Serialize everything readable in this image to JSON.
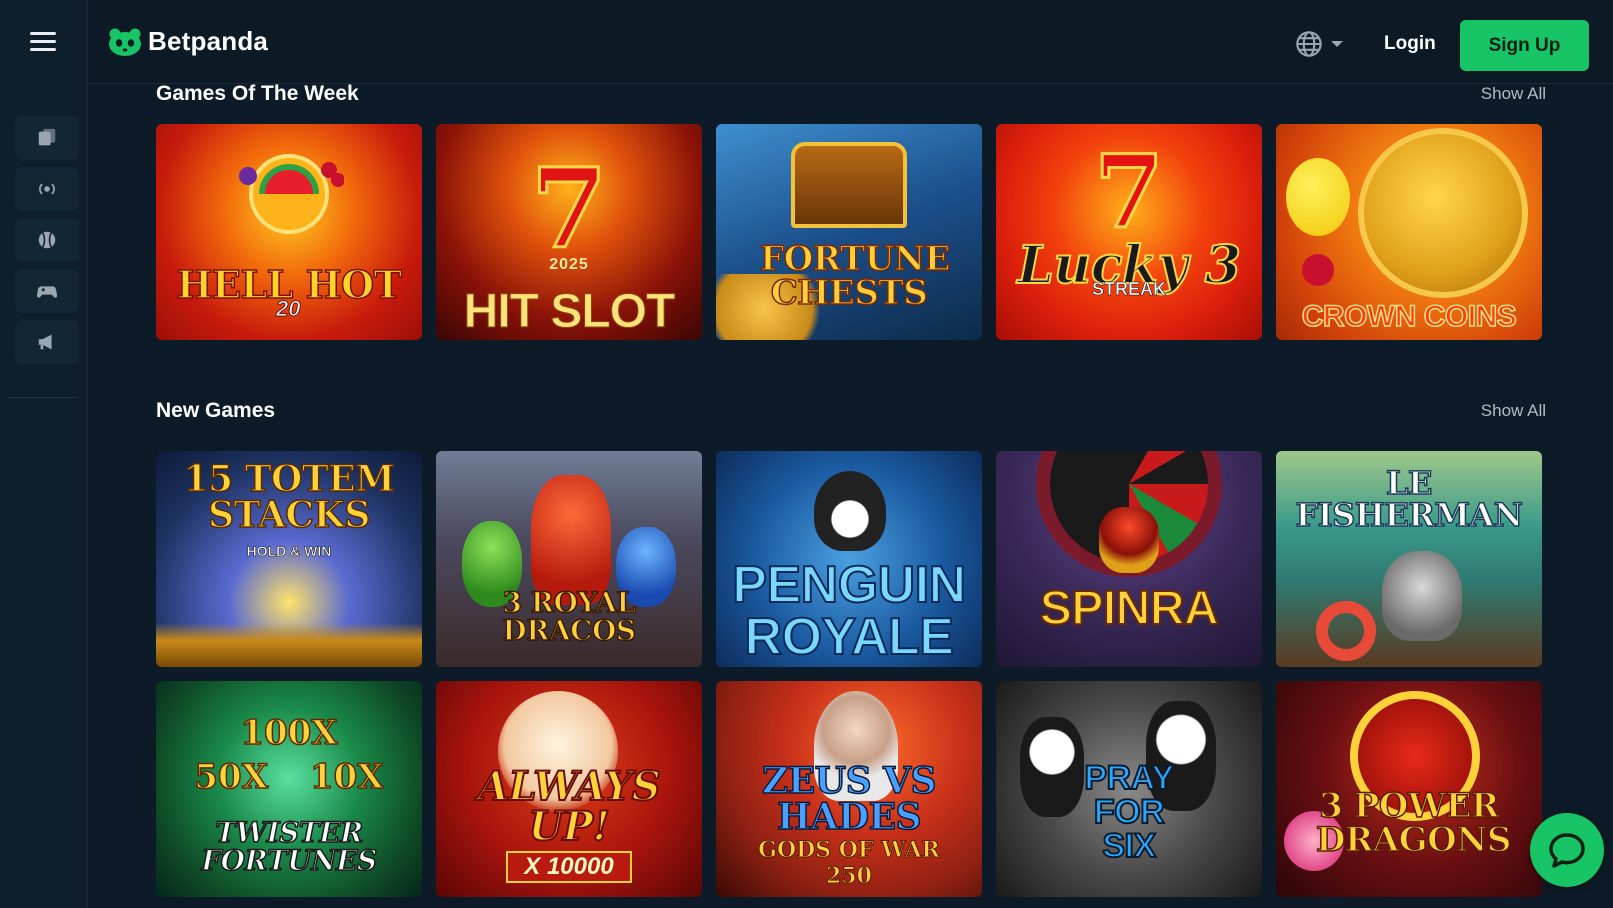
{
  "brand": {
    "name": "Betpanda",
    "accent": "#18c566"
  },
  "header": {
    "login_label": "Login",
    "signup_label": "Sign Up",
    "language_icon": "globe-icon"
  },
  "sidebar": {
    "menu_icon": "menu-icon",
    "items": [
      {
        "icon": "casino-icon"
      },
      {
        "icon": "live-icon"
      },
      {
        "icon": "sports-ball-icon"
      },
      {
        "icon": "gamepad-icon"
      },
      {
        "icon": "megaphone-icon"
      }
    ]
  },
  "sections": [
    {
      "title": "Games Of The Week",
      "show_all": "Show All",
      "games": [
        {
          "title": "HELL HOT",
          "sub": "20",
          "bg": "#c81a0c"
        },
        {
          "title": "HIT SLOT",
          "sub": "2025",
          "bg": "#8a1208"
        },
        {
          "title": "FORTUNE CHESTS",
          "sub": "",
          "bg": "#1b4f8a"
        },
        {
          "title": "Lucky 3",
          "sub": "STREAK",
          "bg": "#d91e0c"
        },
        {
          "title": "CROWN COINS",
          "sub": "",
          "bg": "#e0530a"
        }
      ]
    },
    {
      "title": "New Games",
      "show_all": "Show All",
      "games": [
        {
          "title": "15 TOTEM STACKS",
          "sub": "HOLD & WIN",
          "bg": "#1c3260"
        },
        {
          "title": "3 ROYAL DRACOS",
          "sub": "",
          "bg": "#3a3340"
        },
        {
          "title": "PENGUIN ROYALE",
          "sub": "",
          "bg": "#1a5aa0"
        },
        {
          "title": "SPINRA",
          "sub": "",
          "bg": "#3b2a5a"
        },
        {
          "title": "LE FISHERMAN",
          "sub": "",
          "bg": "#2f7a72"
        },
        {
          "title": "TWISTER FORTUNES",
          "sub": "100X 50X 10X",
          "bg": "#0f4a26"
        },
        {
          "title": "ALWAYS UP!",
          "sub": "X 10000",
          "bg": "#a8140c"
        },
        {
          "title": "ZEUS VS HADES",
          "sub": "GODS OF WAR 250",
          "bg": "#8e2012"
        },
        {
          "title": "PRAY FOR SIX",
          "sub": "",
          "bg": "#4a4a4a"
        },
        {
          "title": "3 POWER DRAGONS",
          "sub": "",
          "bg": "#6a0f12"
        }
      ]
    }
  ],
  "chat_icon": "chat-bubble-icon"
}
